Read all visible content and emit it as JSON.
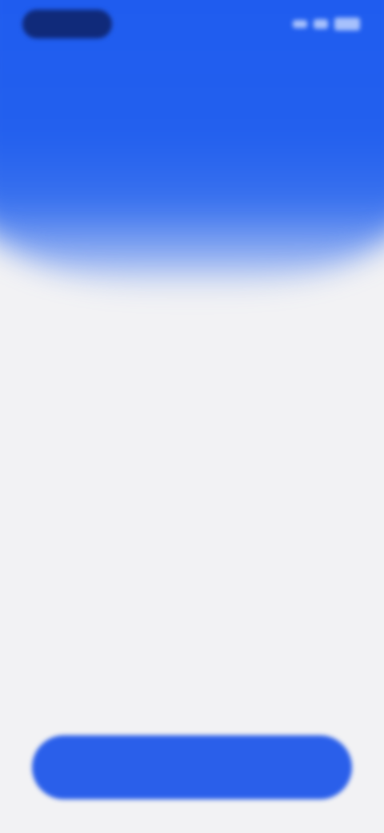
{
  "colors": {
    "primary": "#2360EE",
    "background": "#F2F2F4",
    "text": "#111111",
    "button": "#2A5FEA",
    "button_text": "#FFFFFF"
  },
  "status_bar": {
    "time": "",
    "icons": [
      "signal-icon",
      "wifi-icon",
      "battery-icon"
    ]
  },
  "main": {
    "lines": [
      "",
      "",
      "",
      "",
      ""
    ]
  },
  "cta": {
    "label": ""
  }
}
